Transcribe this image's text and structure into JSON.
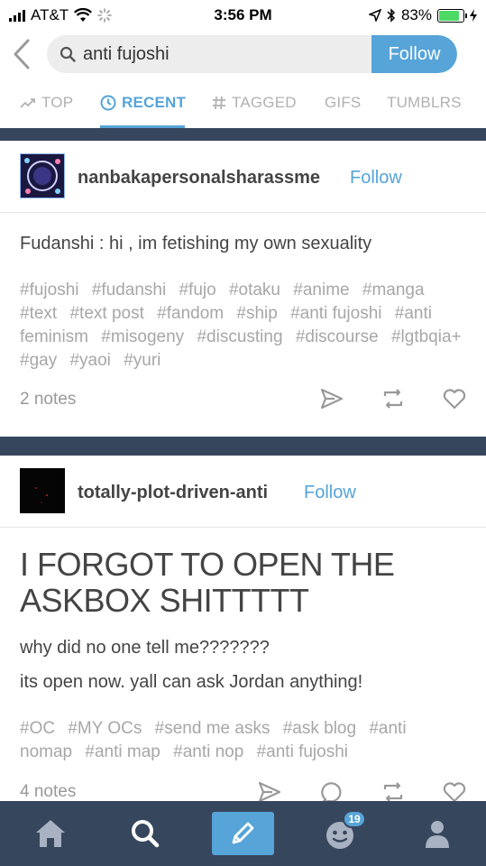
{
  "status_bar": {
    "carrier": "AT&T",
    "time": "3:56 PM",
    "battery_percent": "83%",
    "battery_level": 0.83
  },
  "search": {
    "query": "anti fujoshi",
    "follow_label": "Follow"
  },
  "tabs": [
    {
      "label": "TOP",
      "icon": "trending-icon"
    },
    {
      "label": "RECENT",
      "icon": "clock-icon",
      "active": true
    },
    {
      "label": "TAGGED",
      "icon": "hash-icon"
    },
    {
      "label": "GIFS"
    },
    {
      "label": "TUMBLRS"
    }
  ],
  "posts": [
    {
      "blog_name": "nanbakapersonalsharassme",
      "follow_label": "Follow",
      "text": "Fudanshi : hi , im fetishing my own sexuality",
      "tags": [
        "#fujoshi",
        "#fudanshi",
        "#fujo",
        "#otaku",
        "#anime",
        "#manga",
        "#text",
        "#text post",
        "#fandom",
        "#ship",
        "#anti fujoshi",
        "#anti feminism",
        "#misogeny",
        "#discusting",
        "#discourse",
        "#lgtbqia+",
        "#gay",
        "#yaoi",
        "#yuri"
      ],
      "notes": "2 notes"
    },
    {
      "blog_name": "totally-plot-driven-anti",
      "follow_label": "Follow",
      "title": "I FORGOT TO OPEN THE ASKBOX SHITTTTT",
      "lines": [
        "why did no one tell me???????",
        "its open now. yall can ask Jordan anything!"
      ],
      "tags": [
        "#OC",
        "#MY OCs",
        "#send me asks",
        "#ask blog",
        "#anti nomap",
        "#anti map",
        "#anti nop",
        "#anti fujoshi"
      ],
      "notes": "4 notes"
    }
  ],
  "bottom_nav": {
    "items": [
      "home-icon",
      "search-icon",
      "compose-icon",
      "activity-icon",
      "account-icon"
    ],
    "notification_count": "19"
  },
  "colors": {
    "accent": "#56a4d8",
    "nav_bg": "#36465d",
    "tag_gray": "#a7a7a7"
  }
}
